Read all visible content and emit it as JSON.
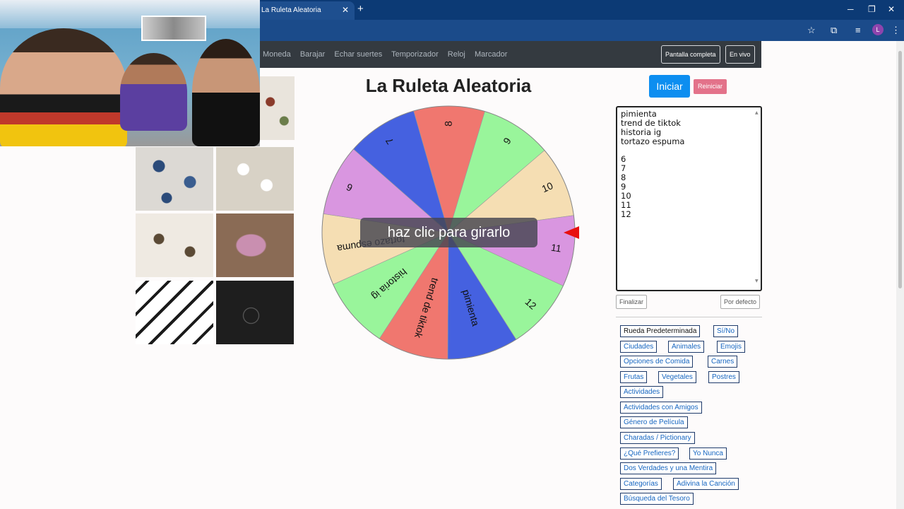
{
  "browser": {
    "tab_title": "La Ruleta Aleatoria",
    "tab_close": "✕",
    "new_tab": "+",
    "profile_initial": "L",
    "window_minimize": "─",
    "window_restore": "❐",
    "window_close": "✕"
  },
  "nav": {
    "links": [
      "Moneda",
      "Barajar",
      "Echar suertes",
      "Temporizador",
      "Reloj",
      "Marcador"
    ],
    "fullscreen_label": "Pantalla completa",
    "live_label": "En vivo"
  },
  "page": {
    "title": "La Ruleta Aleatoria",
    "spin_overlay": "haz clic para girarlo"
  },
  "wheel": {
    "segments": [
      {
        "label": "8",
        "color": "#f0776f"
      },
      {
        "label": "9",
        "color": "#99f59b"
      },
      {
        "label": "10",
        "color": "#f5deb3"
      },
      {
        "label": "11",
        "color": "#d996e0"
      },
      {
        "label": "12",
        "color": "#99f59b"
      },
      {
        "label": "pimienta",
        "color": "#4561e0"
      },
      {
        "label": "trend de tiktok",
        "color": "#f0776f"
      },
      {
        "label": "historia ig",
        "color": "#99f59b"
      },
      {
        "label": "tortazo espuma",
        "color": "#f5deb3"
      },
      {
        "label": "6",
        "color": "#d996e0"
      },
      {
        "label": "7",
        "color": "#4561e0"
      }
    ],
    "pointer_color": "#e81010"
  },
  "controls": {
    "start_label": "Iniciar",
    "reset_label": "Reiniciar",
    "finish_label": "Finalizar",
    "default_label": "Por defecto"
  },
  "entries": [
    "pimienta",
    "trend de tiktok",
    "historia ig",
    "tortazo espuma",
    "",
    "6",
    "7",
    "8",
    "9",
    "10",
    "11",
    "12"
  ],
  "presets": {
    "rueda": "Rueda Predeterminada",
    "sino": "Sí/No",
    "ciudades": "Ciudades",
    "animales": "Animales",
    "emojis": "Emojis",
    "comida": "Opciones de Comida",
    "carnes": "Carnes",
    "frutas": "Frutas",
    "vegetales": "Vegetales",
    "postres": "Postres",
    "actividades": "Actividades",
    "amigos": "Actividades con Amigos",
    "pelicula": "Género de Película",
    "charadas": "Charadas / Pictionary",
    "prefieres": "¿Qué Prefieres?",
    "yonunca": "Yo Nunca",
    "verdades": "Dos Verdades y una Mentira",
    "categorias": "Categorías",
    "cancion": "Adivina la Canción",
    "tesoro": "Búsqueda del Tesoro"
  }
}
